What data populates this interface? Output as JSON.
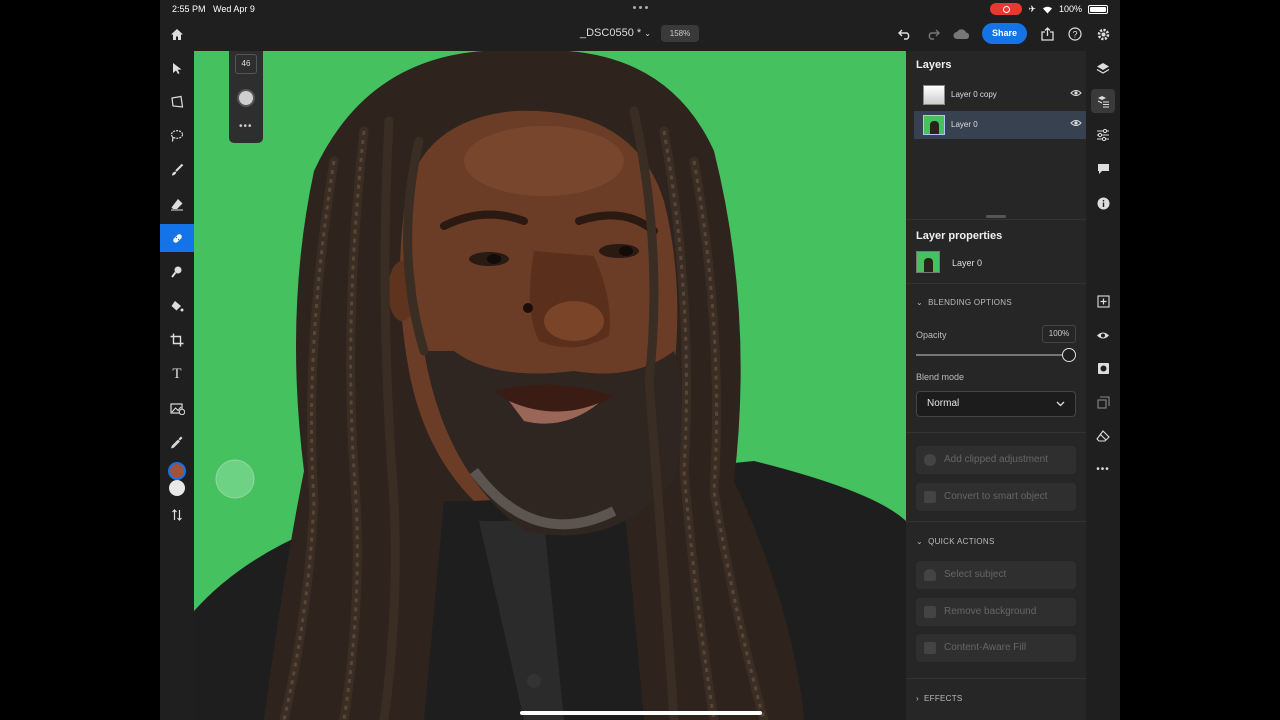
{
  "status": {
    "time": "2:55 PM",
    "date": "Wed Apr 9",
    "battery": "100%"
  },
  "app": {
    "doc_title": "_DSC0550 *",
    "zoom": "158%",
    "share_label": "Share"
  },
  "float_panel": {
    "brush_size": "46"
  },
  "layers": {
    "title": "Layers",
    "items": [
      {
        "name": "Layer 0 copy",
        "selected": false
      },
      {
        "name": "Layer 0",
        "selected": true
      }
    ]
  },
  "layer_properties": {
    "title": "Layer properties",
    "layer_name": "Layer 0",
    "blending_header": "BLENDING OPTIONS",
    "opacity_label": "Opacity",
    "opacity_value": "100%",
    "opacity_fraction": 1.0,
    "blend_label": "Blend mode",
    "blend_value": "Normal",
    "add_clipped": "Add clipped adjustment",
    "convert_smart": "Convert to smart object",
    "quick_actions_header": "QUICK ACTIONS",
    "select_subject": "Select subject",
    "remove_background": "Remove background",
    "content_aware": "Content-Aware Fill",
    "effects_header": "EFFECTS"
  },
  "colors": {
    "accent": "#1473e6",
    "canvas_green": "#45c160",
    "foreground_color": "#a0523c",
    "background_color": "#e8e8e8"
  }
}
